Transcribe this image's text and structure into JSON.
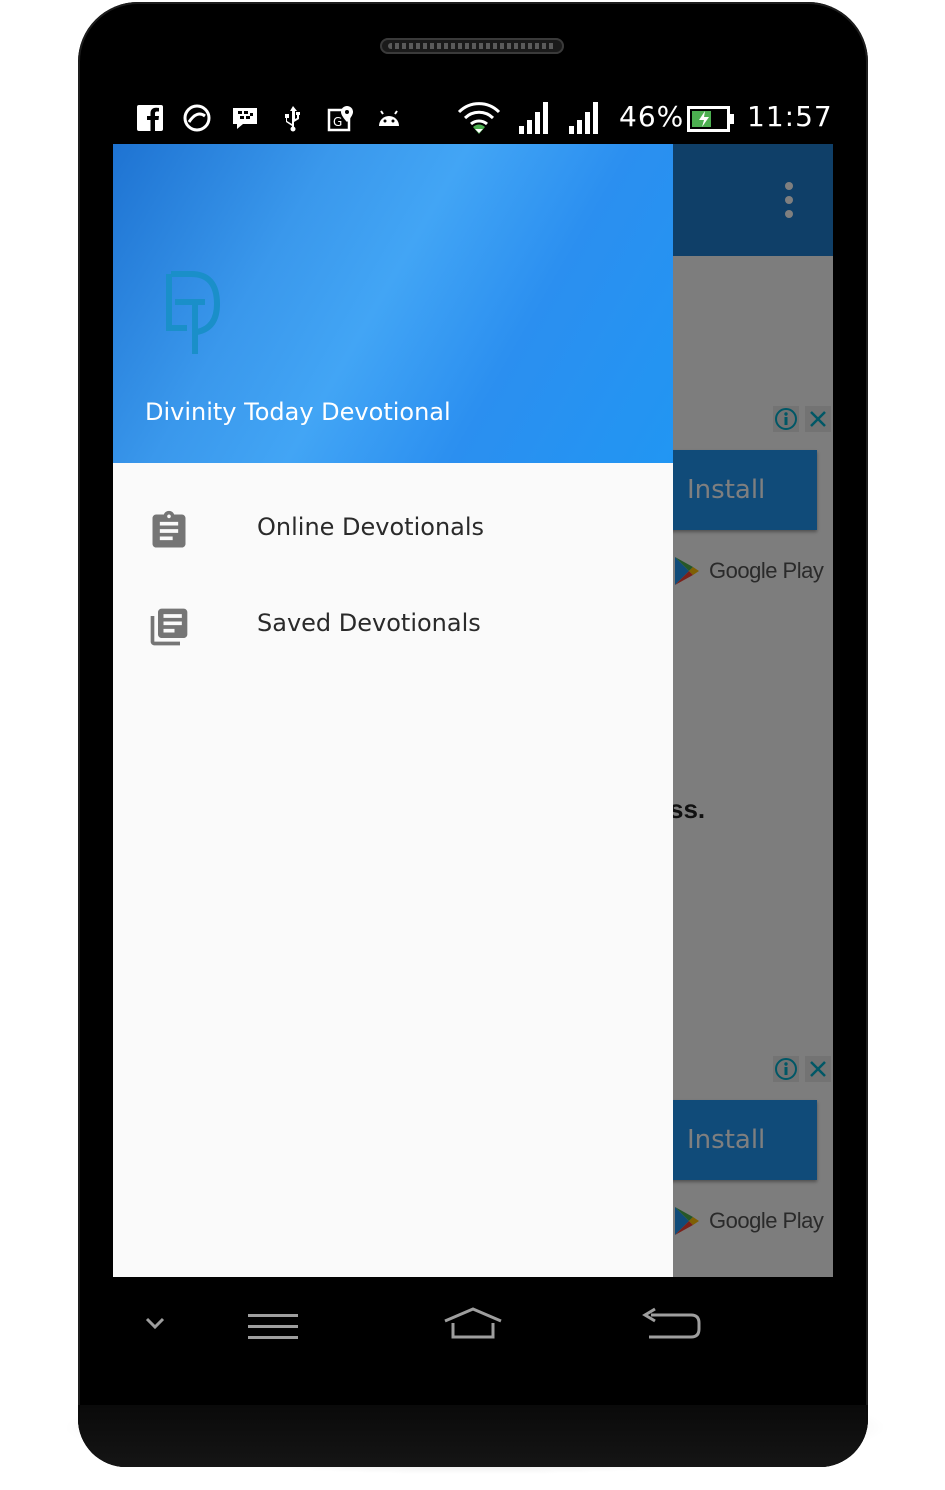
{
  "status_bar": {
    "battery": "46%",
    "time": "11:57",
    "icons": [
      "facebook-icon",
      "headset-app-icon",
      "bbm-icon",
      "usb-icon",
      "location-icon",
      "android-icon",
      "wifi-icon",
      "signal-icon",
      "signal-icon",
      "battery-charging-icon"
    ]
  },
  "app_bar": {
    "overflow_icon": "more-vert-icon"
  },
  "ads": [
    {
      "install_label": "Install",
      "store_label": "Google Play"
    },
    {
      "install_label": "Install",
      "store_label": "Google Play"
    }
  ],
  "content": {
    "fragment_text": "ss."
  },
  "drawer": {
    "header_title": "Divinity Today Devotional",
    "logo_icon": "dt-logo",
    "items": [
      {
        "label": "Online Devotionals",
        "icon": "assignment-icon"
      },
      {
        "label": "Saved Devotionals",
        "icon": "library-books-icon"
      }
    ]
  },
  "nav_bar": {
    "buttons": [
      "hide-nav-icon",
      "menu-icon",
      "home-icon",
      "back-icon"
    ]
  },
  "colors": {
    "primary": "#2196f3",
    "toolbar": "#1f7fd0",
    "drawer_bg": "#fafafa",
    "logo": "#1a8fc9"
  }
}
